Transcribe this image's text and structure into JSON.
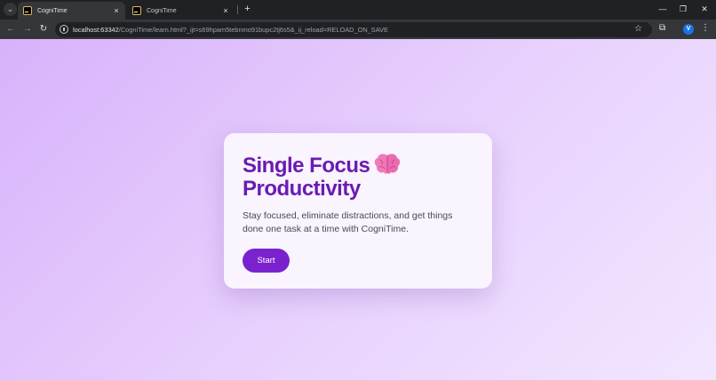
{
  "browser": {
    "tabs": [
      {
        "title": "CogniTime",
        "active": true,
        "close_glyph": "×"
      },
      {
        "title": "CogniTime",
        "active": false,
        "close_glyph": "×"
      }
    ],
    "tab_search_glyph": "⌄",
    "new_tab_glyph": "+",
    "window_controls": {
      "minimize": "—",
      "restore": "❐",
      "close": "✕"
    },
    "nav": {
      "back": "←",
      "forward": "→",
      "reload": "↻"
    },
    "url": {
      "host": "localhost:63342",
      "path": "/CogniTime/learn.html?_ijt=s69hpam5tebnmo91bupc2tj6s5&_ij_reload=RELOAD_ON_SAVE"
    },
    "bookmark_glyph": "☆",
    "extensions_glyph": "⧉",
    "profile_initial": "V",
    "menu_glyph": "⋮"
  },
  "page": {
    "headline_line1": "Single Focus",
    "headline_line2": "Productivity",
    "headline_icon": "brain-icon",
    "subtitle": "Stay focused, eliminate distractions, and get things done one task at a time with CogniTime.",
    "start_label": "Start"
  },
  "colors": {
    "accent": "#7b22cf",
    "headline": "#6a1bb3",
    "background_gradient": [
      "#d8b2fb",
      "#f2e6ff"
    ]
  }
}
